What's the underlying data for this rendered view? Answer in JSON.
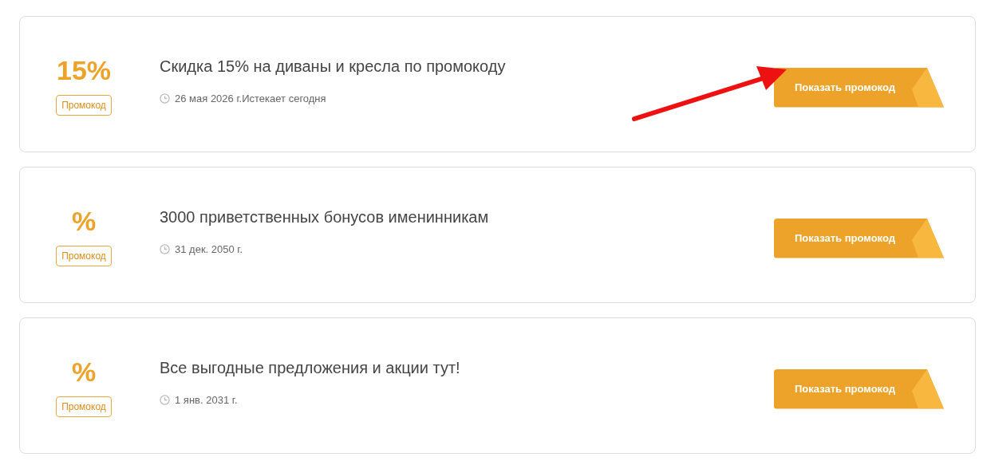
{
  "offers": [
    {
      "discount": "15%",
      "badge": "Промокод",
      "title": "Скидка 15% на диваны и кресла по промокоду",
      "date": "26 мая 2026 г.",
      "note": "Истекает сегодня",
      "button": "Показать промокод",
      "pointed": true
    },
    {
      "discount": "%",
      "badge": "Промокод",
      "title": "3000 приветственных бонусов именинникам",
      "date": "31 дек. 2050 г.",
      "button": "Показать промокод",
      "pointed": false
    },
    {
      "discount": "%",
      "badge": "Промокод",
      "title": "Все выгодные предложения и акции тут!",
      "date": "1 янв. 2031 г.",
      "button": "Показать промокод",
      "pointed": false
    }
  ]
}
